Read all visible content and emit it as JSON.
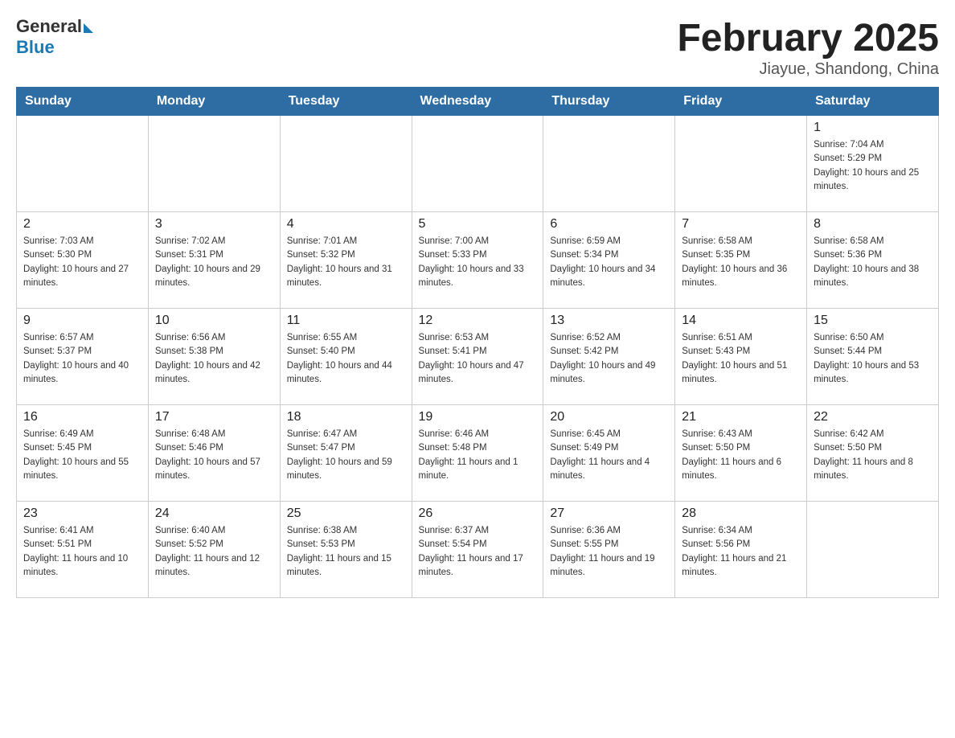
{
  "logo": {
    "general": "General",
    "blue": "Blue"
  },
  "title": "February 2025",
  "location": "Jiayue, Shandong, China",
  "days_of_week": [
    "Sunday",
    "Monday",
    "Tuesday",
    "Wednesday",
    "Thursday",
    "Friday",
    "Saturday"
  ],
  "weeks": [
    [
      {
        "day": "",
        "info": ""
      },
      {
        "day": "",
        "info": ""
      },
      {
        "day": "",
        "info": ""
      },
      {
        "day": "",
        "info": ""
      },
      {
        "day": "",
        "info": ""
      },
      {
        "day": "",
        "info": ""
      },
      {
        "day": "1",
        "info": "Sunrise: 7:04 AM\nSunset: 5:29 PM\nDaylight: 10 hours and 25 minutes."
      }
    ],
    [
      {
        "day": "2",
        "info": "Sunrise: 7:03 AM\nSunset: 5:30 PM\nDaylight: 10 hours and 27 minutes."
      },
      {
        "day": "3",
        "info": "Sunrise: 7:02 AM\nSunset: 5:31 PM\nDaylight: 10 hours and 29 minutes."
      },
      {
        "day": "4",
        "info": "Sunrise: 7:01 AM\nSunset: 5:32 PM\nDaylight: 10 hours and 31 minutes."
      },
      {
        "day": "5",
        "info": "Sunrise: 7:00 AM\nSunset: 5:33 PM\nDaylight: 10 hours and 33 minutes."
      },
      {
        "day": "6",
        "info": "Sunrise: 6:59 AM\nSunset: 5:34 PM\nDaylight: 10 hours and 34 minutes."
      },
      {
        "day": "7",
        "info": "Sunrise: 6:58 AM\nSunset: 5:35 PM\nDaylight: 10 hours and 36 minutes."
      },
      {
        "day": "8",
        "info": "Sunrise: 6:58 AM\nSunset: 5:36 PM\nDaylight: 10 hours and 38 minutes."
      }
    ],
    [
      {
        "day": "9",
        "info": "Sunrise: 6:57 AM\nSunset: 5:37 PM\nDaylight: 10 hours and 40 minutes."
      },
      {
        "day": "10",
        "info": "Sunrise: 6:56 AM\nSunset: 5:38 PM\nDaylight: 10 hours and 42 minutes."
      },
      {
        "day": "11",
        "info": "Sunrise: 6:55 AM\nSunset: 5:40 PM\nDaylight: 10 hours and 44 minutes."
      },
      {
        "day": "12",
        "info": "Sunrise: 6:53 AM\nSunset: 5:41 PM\nDaylight: 10 hours and 47 minutes."
      },
      {
        "day": "13",
        "info": "Sunrise: 6:52 AM\nSunset: 5:42 PM\nDaylight: 10 hours and 49 minutes."
      },
      {
        "day": "14",
        "info": "Sunrise: 6:51 AM\nSunset: 5:43 PM\nDaylight: 10 hours and 51 minutes."
      },
      {
        "day": "15",
        "info": "Sunrise: 6:50 AM\nSunset: 5:44 PM\nDaylight: 10 hours and 53 minutes."
      }
    ],
    [
      {
        "day": "16",
        "info": "Sunrise: 6:49 AM\nSunset: 5:45 PM\nDaylight: 10 hours and 55 minutes."
      },
      {
        "day": "17",
        "info": "Sunrise: 6:48 AM\nSunset: 5:46 PM\nDaylight: 10 hours and 57 minutes."
      },
      {
        "day": "18",
        "info": "Sunrise: 6:47 AM\nSunset: 5:47 PM\nDaylight: 10 hours and 59 minutes."
      },
      {
        "day": "19",
        "info": "Sunrise: 6:46 AM\nSunset: 5:48 PM\nDaylight: 11 hours and 1 minute."
      },
      {
        "day": "20",
        "info": "Sunrise: 6:45 AM\nSunset: 5:49 PM\nDaylight: 11 hours and 4 minutes."
      },
      {
        "day": "21",
        "info": "Sunrise: 6:43 AM\nSunset: 5:50 PM\nDaylight: 11 hours and 6 minutes."
      },
      {
        "day": "22",
        "info": "Sunrise: 6:42 AM\nSunset: 5:50 PM\nDaylight: 11 hours and 8 minutes."
      }
    ],
    [
      {
        "day": "23",
        "info": "Sunrise: 6:41 AM\nSunset: 5:51 PM\nDaylight: 11 hours and 10 minutes."
      },
      {
        "day": "24",
        "info": "Sunrise: 6:40 AM\nSunset: 5:52 PM\nDaylight: 11 hours and 12 minutes."
      },
      {
        "day": "25",
        "info": "Sunrise: 6:38 AM\nSunset: 5:53 PM\nDaylight: 11 hours and 15 minutes."
      },
      {
        "day": "26",
        "info": "Sunrise: 6:37 AM\nSunset: 5:54 PM\nDaylight: 11 hours and 17 minutes."
      },
      {
        "day": "27",
        "info": "Sunrise: 6:36 AM\nSunset: 5:55 PM\nDaylight: 11 hours and 19 minutes."
      },
      {
        "day": "28",
        "info": "Sunrise: 6:34 AM\nSunset: 5:56 PM\nDaylight: 11 hours and 21 minutes."
      },
      {
        "day": "",
        "info": ""
      }
    ]
  ]
}
